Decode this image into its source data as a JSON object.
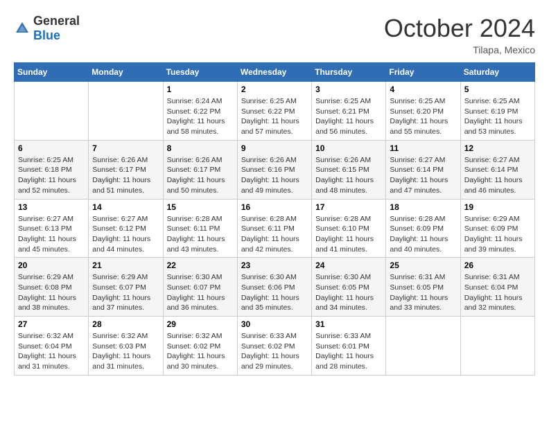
{
  "logo": {
    "text_general": "General",
    "text_blue": "Blue"
  },
  "header": {
    "month": "October 2024",
    "location": "Tilapa, Mexico"
  },
  "weekdays": [
    "Sunday",
    "Monday",
    "Tuesday",
    "Wednesday",
    "Thursday",
    "Friday",
    "Saturday"
  ],
  "weeks": [
    [
      {
        "day": "",
        "sunrise": "",
        "sunset": "",
        "daylight": ""
      },
      {
        "day": "",
        "sunrise": "",
        "sunset": "",
        "daylight": ""
      },
      {
        "day": "1",
        "sunrise": "Sunrise: 6:24 AM",
        "sunset": "Sunset: 6:22 PM",
        "daylight": "Daylight: 11 hours and 58 minutes."
      },
      {
        "day": "2",
        "sunrise": "Sunrise: 6:25 AM",
        "sunset": "Sunset: 6:22 PM",
        "daylight": "Daylight: 11 hours and 57 minutes."
      },
      {
        "day": "3",
        "sunrise": "Sunrise: 6:25 AM",
        "sunset": "Sunset: 6:21 PM",
        "daylight": "Daylight: 11 hours and 56 minutes."
      },
      {
        "day": "4",
        "sunrise": "Sunrise: 6:25 AM",
        "sunset": "Sunset: 6:20 PM",
        "daylight": "Daylight: 11 hours and 55 minutes."
      },
      {
        "day": "5",
        "sunrise": "Sunrise: 6:25 AM",
        "sunset": "Sunset: 6:19 PM",
        "daylight": "Daylight: 11 hours and 53 minutes."
      }
    ],
    [
      {
        "day": "6",
        "sunrise": "Sunrise: 6:25 AM",
        "sunset": "Sunset: 6:18 PM",
        "daylight": "Daylight: 11 hours and 52 minutes."
      },
      {
        "day": "7",
        "sunrise": "Sunrise: 6:26 AM",
        "sunset": "Sunset: 6:17 PM",
        "daylight": "Daylight: 11 hours and 51 minutes."
      },
      {
        "day": "8",
        "sunrise": "Sunrise: 6:26 AM",
        "sunset": "Sunset: 6:17 PM",
        "daylight": "Daylight: 11 hours and 50 minutes."
      },
      {
        "day": "9",
        "sunrise": "Sunrise: 6:26 AM",
        "sunset": "Sunset: 6:16 PM",
        "daylight": "Daylight: 11 hours and 49 minutes."
      },
      {
        "day": "10",
        "sunrise": "Sunrise: 6:26 AM",
        "sunset": "Sunset: 6:15 PM",
        "daylight": "Daylight: 11 hours and 48 minutes."
      },
      {
        "day": "11",
        "sunrise": "Sunrise: 6:27 AM",
        "sunset": "Sunset: 6:14 PM",
        "daylight": "Daylight: 11 hours and 47 minutes."
      },
      {
        "day": "12",
        "sunrise": "Sunrise: 6:27 AM",
        "sunset": "Sunset: 6:14 PM",
        "daylight": "Daylight: 11 hours and 46 minutes."
      }
    ],
    [
      {
        "day": "13",
        "sunrise": "Sunrise: 6:27 AM",
        "sunset": "Sunset: 6:13 PM",
        "daylight": "Daylight: 11 hours and 45 minutes."
      },
      {
        "day": "14",
        "sunrise": "Sunrise: 6:27 AM",
        "sunset": "Sunset: 6:12 PM",
        "daylight": "Daylight: 11 hours and 44 minutes."
      },
      {
        "day": "15",
        "sunrise": "Sunrise: 6:28 AM",
        "sunset": "Sunset: 6:11 PM",
        "daylight": "Daylight: 11 hours and 43 minutes."
      },
      {
        "day": "16",
        "sunrise": "Sunrise: 6:28 AM",
        "sunset": "Sunset: 6:11 PM",
        "daylight": "Daylight: 11 hours and 42 minutes."
      },
      {
        "day": "17",
        "sunrise": "Sunrise: 6:28 AM",
        "sunset": "Sunset: 6:10 PM",
        "daylight": "Daylight: 11 hours and 41 minutes."
      },
      {
        "day": "18",
        "sunrise": "Sunrise: 6:28 AM",
        "sunset": "Sunset: 6:09 PM",
        "daylight": "Daylight: 11 hours and 40 minutes."
      },
      {
        "day": "19",
        "sunrise": "Sunrise: 6:29 AM",
        "sunset": "Sunset: 6:09 PM",
        "daylight": "Daylight: 11 hours and 39 minutes."
      }
    ],
    [
      {
        "day": "20",
        "sunrise": "Sunrise: 6:29 AM",
        "sunset": "Sunset: 6:08 PM",
        "daylight": "Daylight: 11 hours and 38 minutes."
      },
      {
        "day": "21",
        "sunrise": "Sunrise: 6:29 AM",
        "sunset": "Sunset: 6:07 PM",
        "daylight": "Daylight: 11 hours and 37 minutes."
      },
      {
        "day": "22",
        "sunrise": "Sunrise: 6:30 AM",
        "sunset": "Sunset: 6:07 PM",
        "daylight": "Daylight: 11 hours and 36 minutes."
      },
      {
        "day": "23",
        "sunrise": "Sunrise: 6:30 AM",
        "sunset": "Sunset: 6:06 PM",
        "daylight": "Daylight: 11 hours and 35 minutes."
      },
      {
        "day": "24",
        "sunrise": "Sunrise: 6:30 AM",
        "sunset": "Sunset: 6:05 PM",
        "daylight": "Daylight: 11 hours and 34 minutes."
      },
      {
        "day": "25",
        "sunrise": "Sunrise: 6:31 AM",
        "sunset": "Sunset: 6:05 PM",
        "daylight": "Daylight: 11 hours and 33 minutes."
      },
      {
        "day": "26",
        "sunrise": "Sunrise: 6:31 AM",
        "sunset": "Sunset: 6:04 PM",
        "daylight": "Daylight: 11 hours and 32 minutes."
      }
    ],
    [
      {
        "day": "27",
        "sunrise": "Sunrise: 6:32 AM",
        "sunset": "Sunset: 6:04 PM",
        "daylight": "Daylight: 11 hours and 31 minutes."
      },
      {
        "day": "28",
        "sunrise": "Sunrise: 6:32 AM",
        "sunset": "Sunset: 6:03 PM",
        "daylight": "Daylight: 11 hours and 31 minutes."
      },
      {
        "day": "29",
        "sunrise": "Sunrise: 6:32 AM",
        "sunset": "Sunset: 6:02 PM",
        "daylight": "Daylight: 11 hours and 30 minutes."
      },
      {
        "day": "30",
        "sunrise": "Sunrise: 6:33 AM",
        "sunset": "Sunset: 6:02 PM",
        "daylight": "Daylight: 11 hours and 29 minutes."
      },
      {
        "day": "31",
        "sunrise": "Sunrise: 6:33 AM",
        "sunset": "Sunset: 6:01 PM",
        "daylight": "Daylight: 11 hours and 28 minutes."
      },
      {
        "day": "",
        "sunrise": "",
        "sunset": "",
        "daylight": ""
      },
      {
        "day": "",
        "sunrise": "",
        "sunset": "",
        "daylight": ""
      }
    ]
  ]
}
